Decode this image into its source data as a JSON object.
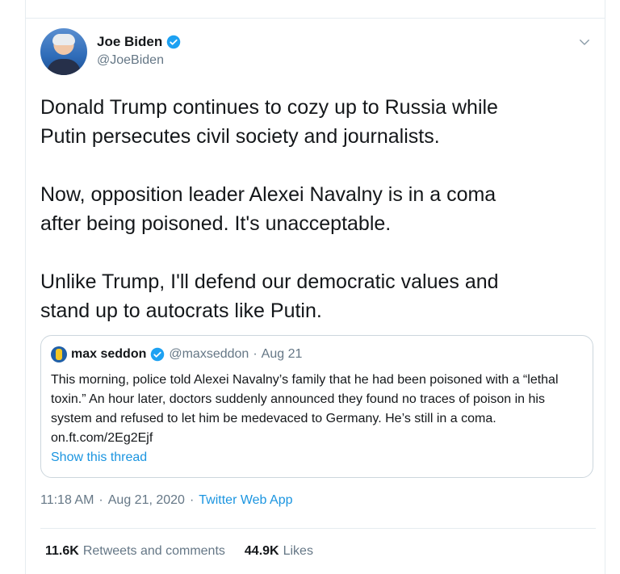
{
  "author": {
    "name": "Joe Biden",
    "handle": "@JoeBiden"
  },
  "tweet": {
    "text": "Donald Trump continues to cozy up to Russia while\nPutin persecutes civil society and journalists.\n\nNow, opposition leader Alexei Navalny is in a coma\nafter being poisoned. It's unacceptable.\n\nUnlike Trump, I'll defend our democratic values and\nstand up to autocrats like Putin.",
    "time": "11:18 AM",
    "sep1": "·",
    "date": "Aug 21, 2020",
    "sep2": "·",
    "source": "Twitter Web App"
  },
  "quote": {
    "name": "max seddon",
    "handle": "@maxseddon",
    "sep": "·",
    "date": "Aug 21",
    "text": "This morning, police told Alexei Navalny’s family that he had been poisoned with a “lethal toxin.” An hour later, doctors suddenly announced they found no traces of poison in his system and refused to let him be medevaced to Germany. He’s still in a coma. on.ft.com/2Eg2Ejf",
    "thread_link": "Show this thread"
  },
  "stats": {
    "retweets_count": "11.6K",
    "retweets_label": "Retweets and comments",
    "likes_count": "44.9K",
    "likes_label": "Likes"
  },
  "colors": {
    "accent": "#1b95e0",
    "muted": "#657786",
    "border": "#e6ecf0"
  }
}
